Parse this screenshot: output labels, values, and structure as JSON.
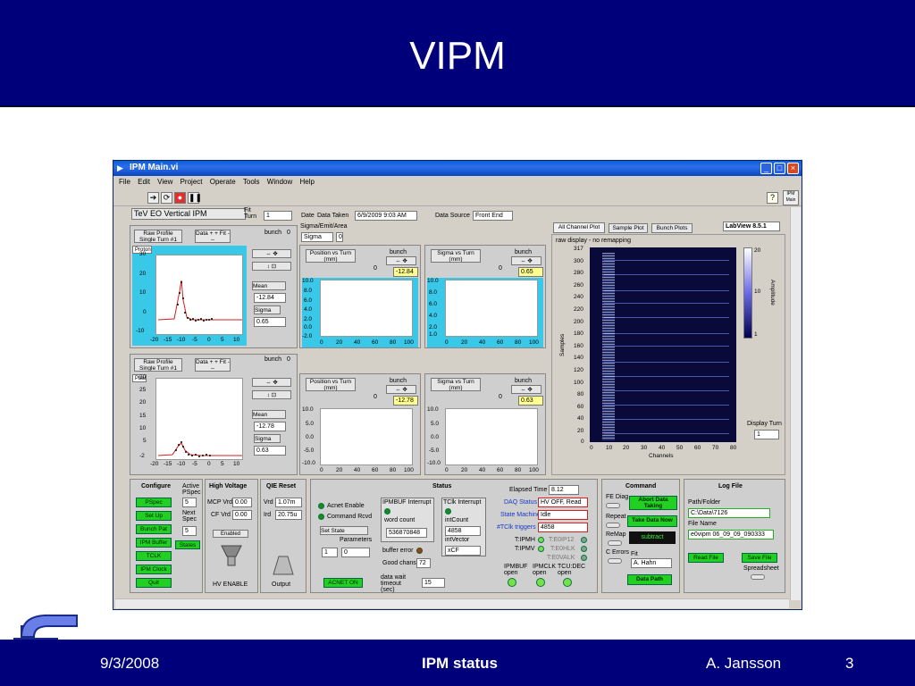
{
  "slide": {
    "title": "VIPM",
    "date": "9/3/2008",
    "footer_center": "IPM status",
    "author": "A. Jansson",
    "page": "3"
  },
  "window": {
    "title": "IPM Main.vi",
    "menus": [
      "File",
      "Edit",
      "View",
      "Project",
      "Operate",
      "Tools",
      "Window",
      "Help"
    ],
    "vi_title": "TeV EO Vertical IPM",
    "fit_label": "Fit Turn",
    "fit_value": "1",
    "date_label": "Date",
    "data_taken_label": "Data Taken",
    "data_taken_value": "6/9/2009 9:03 AM",
    "data_source_label": "Data Source",
    "data_source_value": "Front End"
  },
  "proton": {
    "raw_btn": "Raw Profile Single Turn #1",
    "data_fit_btn": "Data + + Fit ---",
    "bunch_label": "bunch",
    "bunch_value": "0",
    "legend": "Proton",
    "mean_label": "Mean",
    "mean_value": "-12.84",
    "sigma_label": "Sigma",
    "sigma_value": "0.65",
    "yticks": [
      "30",
      "20",
      "10",
      "0",
      "-10"
    ],
    "xticks": [
      "-20",
      "-15",
      "-10",
      "-5",
      "0",
      "5",
      "10"
    ]
  },
  "sigma_area": {
    "label": "Sigma/Emit/Area",
    "select": "Sigma",
    "value": "0"
  },
  "pos_turn_top": {
    "title": "Position vs Turn (mm)",
    "bunch_label": "bunch",
    "value": "-12.84",
    "field": "0",
    "yticks": [
      "10.0",
      "8.0",
      "6.0",
      "4.0",
      "2.0",
      "0.0",
      "-2.0"
    ],
    "xticks": [
      "0",
      "20",
      "40",
      "60",
      "80",
      "100"
    ]
  },
  "sig_turn_top": {
    "title": "Sigma vs Turn (mm)",
    "bunch_label": "bunch",
    "value": "0.65",
    "field": "0",
    "yticks": [
      "10.0",
      "8.0",
      "6.0",
      "4.0",
      "2.0",
      "1.0"
    ],
    "xticks": [
      "0",
      "20",
      "40",
      "60",
      "80",
      "100"
    ]
  },
  "pbar": {
    "raw_btn": "Raw Profile Single Turn #1",
    "data_fit_btn": "Data + + Fit ---",
    "bunch_label": "bunch",
    "bunch_value": "0",
    "legend": "Pbar",
    "mean_label": "Mean",
    "mean_value": "-12.78",
    "sigma_label": "Sigma",
    "sigma_value": "0.63",
    "yticks": [
      "30",
      "25",
      "20",
      "15",
      "10",
      "5",
      "-2"
    ],
    "xticks": [
      "-20",
      "-15",
      "-10",
      "-5",
      "0",
      "5",
      "10"
    ]
  },
  "pos_turn_bot": {
    "title": "Position vs Turn (mm)",
    "bunch_label": "bunch",
    "value": "-12.78",
    "field": "0",
    "yticks": [
      "10.0",
      "5.0",
      "0.0",
      "-5.0",
      "-10.0"
    ],
    "xticks": [
      "0",
      "20",
      "40",
      "60",
      "80",
      "100"
    ]
  },
  "sig_turn_bot": {
    "title": "Sigma vs Turn (mm)",
    "bunch_label": "bunch",
    "value": "0.63",
    "field": "0",
    "yticks": [
      "10.0",
      "5.0",
      "0.0",
      "-5.0",
      "-10.0"
    ],
    "xticks": [
      "0",
      "20",
      "40",
      "60",
      "80",
      "100"
    ]
  },
  "tabs": [
    "All Channel Plot",
    "Sample Plot",
    "Bunch Plots"
  ],
  "labview": "LabView 8.5.1",
  "heatmap": {
    "subtitle": "raw display - no remapping",
    "yticks": [
      "317",
      "300",
      "280",
      "260",
      "240",
      "220",
      "200",
      "180",
      "160",
      "140",
      "120",
      "100",
      "80",
      "60",
      "40",
      "20",
      "0"
    ],
    "xticks": [
      "0",
      "10",
      "20",
      "30",
      "40",
      "50",
      "60",
      "70",
      "80"
    ],
    "ylabel": "Samples",
    "xlabel": "Channels",
    "scale_ticks": [
      "20",
      "10",
      "1"
    ],
    "scale_label": "Amplitude",
    "display_turn_label": "Display Turn",
    "display_turn_value": "1"
  },
  "configure": {
    "title": "Configure",
    "active_label": "Active PSpec",
    "active_value": "5",
    "next_label": "Next Spec",
    "next_value": "5",
    "buttons": [
      "PSpec",
      "Set Up",
      "Bunch Pat",
      "IPM Buffer",
      "TCLK",
      "IPM Clock",
      "Quit"
    ],
    "states_btn": "States"
  },
  "hv": {
    "title": "High Voltage",
    "mcp_label": "MCP Vrd",
    "mcp_value": "0.00",
    "cf_label": "CF Vrd",
    "cf_value": "0.00",
    "enabled": "Enabled",
    "hv_enable": "HV ENABLE"
  },
  "qie": {
    "title": "QIE Reset",
    "vrd_label": "Vrd",
    "vrd_value": "1.07m",
    "ird_label": "Ird",
    "ird_value": "20.75u",
    "output": "Output"
  },
  "status": {
    "title": "Status",
    "acnet_enable": "Acnet Enable",
    "command_rcvd": "Command Rcvd",
    "set_state": "Set State",
    "parameters": "Parameters",
    "param_index": "1",
    "param_value": "0",
    "acnet_on": "ACNET ON",
    "data_wait_label": "data wait timeout (sec)",
    "data_wait_value": "15",
    "ipmbuf_interrupt": "IPMBUF Interrupt",
    "word_count_label": "word count",
    "word_count_value": "536870848",
    "buffer_error": "buffer error",
    "good_chans_label": "Good chans",
    "good_chans_value": "72",
    "tclk_interrupt": "TClk Interrupt",
    "intcount_label": "intCount",
    "intcount_value": "4858",
    "intvector_label": "intVector",
    "intvector_value": "xCF",
    "elapsed_label": "Elapsed Time",
    "elapsed_value": "8.12",
    "daq_label": "DAQ Status",
    "daq_value": "HV OFF, Read",
    "sm_label": "State Machine",
    "sm_value": "Idle",
    "triggers_label": "#TClk triggers",
    "triggers_value": "4858",
    "t_ipmh": "T:IPMH",
    "t_ipmv": "T:IPMV",
    "t_e0ip12": "T:E0IP12",
    "t_e0hlk": "T:E0HLK",
    "t_e0valk": "T:E0VALK",
    "ipmbuf_open": "IPMBUF open",
    "ipmclk_open": "IPMCLK open",
    "tcudec_open": "TCU:DEC open"
  },
  "command": {
    "title": "Command",
    "fe_diag": "FE Diag",
    "abort": "Abort Data Taking",
    "repeat": "Repeat",
    "take_data": "Take Data Now",
    "remap": "ReMap",
    "subtract": "subtract",
    "c_errors": "C Errors",
    "fit_label": "Fit",
    "fit_value": "A. Hahn",
    "data_path": "Data Path"
  },
  "logfile": {
    "title": "Log File",
    "path_label": "Path/Folder",
    "path_value": "C:\\Data\\7126",
    "name_label": "File Name",
    "name_value": "e0vipm 06_09_09_090333",
    "read_btn": "Read File",
    "save_btn": "Save File",
    "spreadsheet": "Spreadsheet"
  },
  "colors": {
    "slide_blue": "#00007a",
    "plot_cyan": "#39c8e8",
    "led_green": "#1c8a1c",
    "button_green": "#22d022"
  }
}
